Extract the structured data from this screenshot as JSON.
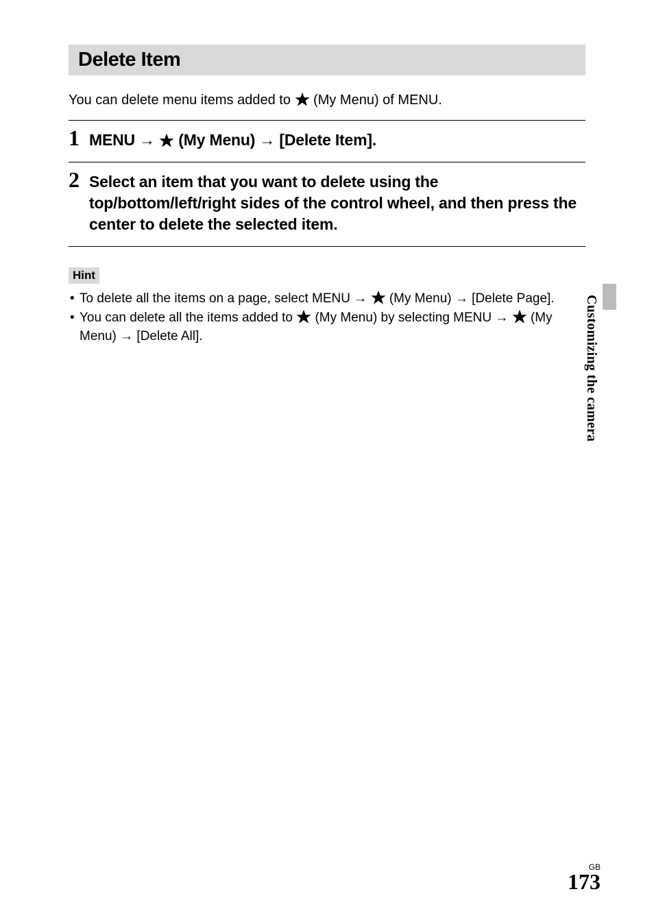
{
  "section": {
    "title": "Delete Item"
  },
  "intro": {
    "before_icon": "You can delete menu items added to ",
    "after_icon": " (My Menu) of MENU."
  },
  "steps": [
    {
      "num": "1",
      "before_icon": "MENU → ",
      "after_icon": " (My Menu) → [Delete Item]."
    },
    {
      "num": "2",
      "text": "Select an item that you want to delete using the top/bottom/left/right sides of the control wheel, and then press the center to delete the selected item."
    }
  ],
  "hint": {
    "label": "Hint",
    "items": [
      {
        "part1": "To delete all the items on a page, select MENU → ",
        "part2": " (My Menu) → [Delete Page]."
      },
      {
        "part1": "You can delete all the items added to ",
        "part2": " (My Menu) by selecting MENU → ",
        "part3": " (My Menu) → [Delete All]."
      }
    ]
  },
  "side_label": "Customizing the camera",
  "footer": {
    "region": "GB",
    "page": "173"
  },
  "icons": {
    "star": "star"
  }
}
